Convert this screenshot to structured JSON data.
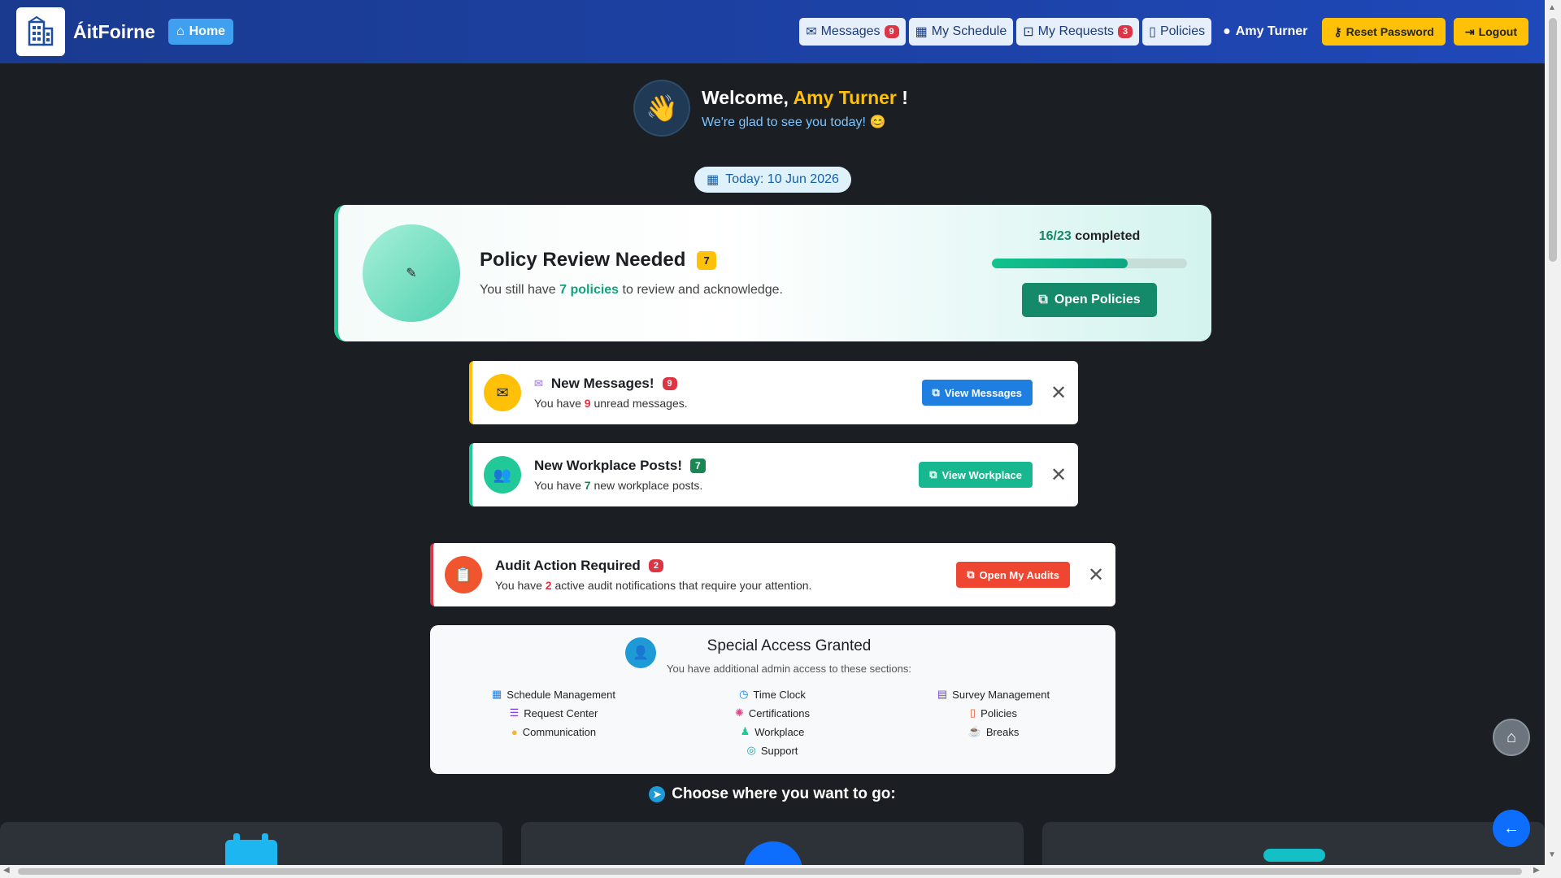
{
  "navbar": {
    "brand": "ÁitFoirne",
    "home": "Home",
    "messages": "Messages",
    "messages_count": "9",
    "schedule": "My Schedule",
    "requests": "My Requests",
    "requests_count": "3",
    "policies": "Policies",
    "user": "Amy Turner",
    "reset_password": "Reset Password",
    "logout": "Logout"
  },
  "welcome": {
    "greeting": "Welcome,",
    "name": "Amy Turner",
    "exclaim": "!",
    "subtitle": "We're glad to see you today! 😊"
  },
  "date_pill": "Today: 10 Jun 2026",
  "policy": {
    "title": "Policy Review Needed",
    "badge": "7",
    "sub_prefix": "You still have",
    "sub_bold": "7 policies",
    "sub_suffix": "to review and acknowledge.",
    "completed_num": "16/23",
    "completed_label": "completed",
    "progress_fraction": 0.696,
    "button": "Open Policies"
  },
  "notifications": {
    "messages": {
      "title": "New Messages!",
      "badge": "9",
      "sub_prefix": "You have",
      "sub_num": "9",
      "sub_suffix": "unread messages.",
      "button": "View Messages"
    },
    "workplace": {
      "title": "New Workplace Posts!",
      "badge": "7",
      "sub_prefix": "You have",
      "sub_num": "7",
      "sub_suffix": "new workplace posts.",
      "button": "View Workplace"
    },
    "audit": {
      "title": "Audit Action Required",
      "badge": "2",
      "sub_prefix": "You have",
      "sub_num": "2",
      "sub_suffix": "active audit notifications that require your attention.",
      "button": "Open My Audits"
    }
  },
  "access": {
    "title": "Special Access Granted",
    "subtitle": "You have additional admin access to these sections:",
    "col1": [
      "Schedule Management",
      "Request Center",
      "Communication"
    ],
    "col2": [
      "Time Clock",
      "Certifications",
      "Workplace",
      "Support"
    ],
    "col3": [
      "Survey Management",
      "Policies",
      "Breaks"
    ]
  },
  "choose": "Choose where you want to go:",
  "colors": {
    "navbar": "#1f48b8",
    "accent_yellow": "#ffc107",
    "green": "#148a6a",
    "red": "#dc3545",
    "blue": "#0d6efd"
  }
}
